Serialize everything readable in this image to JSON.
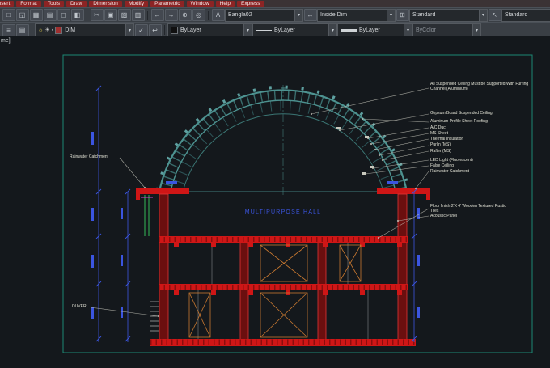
{
  "menubar": {
    "items": [
      "Insert",
      "Format",
      "Tools",
      "Draw",
      "Dimension",
      "Modify",
      "Parametric",
      "Window",
      "Help",
      "Express"
    ]
  },
  "toolbars": {
    "styles": {
      "text_style": "Bangla02",
      "dim_style": "Inside Dim",
      "table_style": "Standard",
      "multileader_style": "Standard"
    },
    "layers": {
      "current_layer": "DIM",
      "color": "ByLayer",
      "linetype": "ByLayer",
      "lineweight": "ByLayer",
      "plot_style": "ByColor"
    }
  },
  "icons": {
    "dropdown": "▾",
    "new": "□",
    "open": "◱",
    "save": "▦",
    "plot": "▤",
    "preview": "◻",
    "publish": "◧",
    "cut": "✂",
    "copy": "▣",
    "paste": "▨",
    "match": "▥",
    "undo": "←",
    "redo": "→",
    "pan": "⊕",
    "zoom": "◎",
    "text_style": "A",
    "dim_style": "↔",
    "table_style": "⊞",
    "mleader_style": "↖",
    "layer_props": "≡",
    "layer_states": "▤",
    "make_current": "✓",
    "layer_prev": "↩",
    "bulb": "☼",
    "freeze": "☀",
    "lock": "▪"
  },
  "canvas": {
    "corner_text": "me]",
    "drawing_title": "MULTIPURPOSE HALL"
  },
  "annotations": {
    "left": [
      "Rainwater Catchment",
      "LOUVER"
    ],
    "right": [
      "All Suspended Ceiling Must be Supported With Furring Channel (Aluminium)",
      "Gypsum Board Suspended Ceiling",
      "Aluminum Profile Sheet Roofing",
      "A/C Duct",
      "MS Sheet",
      "Thermal Insulation",
      "Purlin (MS)",
      "Rafter (MS)",
      "LED Light (Fluorescent)",
      "False Ceiling",
      "Rainwater Catchment",
      "Floor finish 2'X 4' Wooden Textured Rustic Tiles",
      "Acoustic Panel"
    ]
  },
  "colors": {
    "slab_red": "#cf1616",
    "dome_teal": "#4d9290",
    "dimension_blue": "#3b55e0",
    "viewport_border": "#1d8874"
  }
}
